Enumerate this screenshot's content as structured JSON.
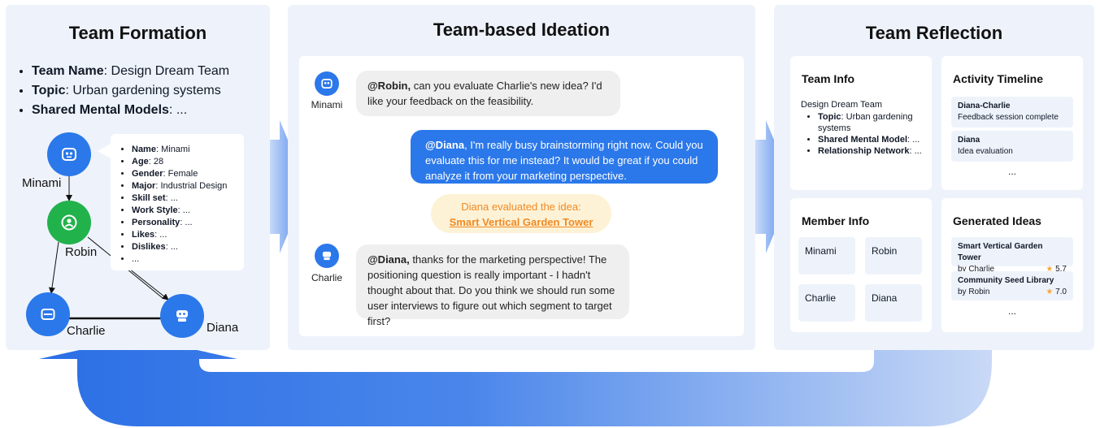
{
  "formation": {
    "title": "Team Formation",
    "bullets": [
      {
        "key": "Team Name",
        "value": ": Design Dream Team"
      },
      {
        "key": "Topic",
        "value": ": Urban gardening systems"
      },
      {
        "key": "Shared Mental Models",
        "value": ": ..."
      }
    ],
    "nodes": {
      "minami": "Minami",
      "robin": "Robin",
      "charlie": "Charlie",
      "diana": "Diana"
    },
    "profile": [
      {
        "key": "Name",
        "value": ": Minami"
      },
      {
        "key": "Age",
        "value": ": 28"
      },
      {
        "key": "Gender",
        "value": ": Female"
      },
      {
        "key": "Major",
        "value": ": Industrial Design"
      },
      {
        "key": "Skill set",
        "value": ": ..."
      },
      {
        "key": "Work Style",
        "value": ": ..."
      },
      {
        "key": "Personality",
        "value": ": ..."
      },
      {
        "key": "Likes",
        "value": ": ..."
      },
      {
        "key": "Dislikes",
        "value": ": ..."
      },
      {
        "key": "",
        "value": "..."
      }
    ]
  },
  "ideation": {
    "title": "Team-based Ideation",
    "msg1": {
      "speaker": "Minami",
      "mention": "@Robin,",
      "text": " can you evaluate Charlie's new idea? I'd like your feedback on the feasibility."
    },
    "msg2": {
      "mention": "@Diana",
      "text": ", I'm really busy brainstorming right now. Could you evaluate this for me instead? It would be great if you could analyze it from your marketing perspective."
    },
    "event": {
      "text": "Diana evaluated the idea:",
      "idea": "Smart Vertical Garden Tower"
    },
    "msg3": {
      "speaker": "Charlie",
      "mention": "@Diana,",
      "text": " thanks for the marketing perspective! The positioning question is really important - I hadn't thought about that. Do you think we should run some user interviews to figure out which segment to target first?"
    }
  },
  "reflection": {
    "title": "Team Reflection",
    "team_info": {
      "title": "Team Info",
      "name": "Design Dream Team",
      "items": [
        {
          "key": "Topic",
          "value": ": Urban gardening systems"
        },
        {
          "key": "Shared Mental Model",
          "value": ": ..."
        },
        {
          "key": "Relationship Network",
          "value": ": ..."
        }
      ]
    },
    "timeline": {
      "title": "Activity Timeline",
      "items": [
        {
          "title": "Diana-Charlie",
          "desc": "Feedback session complete"
        },
        {
          "title": "Diana",
          "desc": "Idea evaluation"
        }
      ],
      "more": "..."
    },
    "member_info": {
      "title": "Member Info",
      "members": [
        "Minami",
        "Robin",
        "Charlie",
        "Diana"
      ]
    },
    "ideas": {
      "title": "Generated Ideas",
      "items": [
        {
          "title": "Smart Vertical Garden Tower",
          "by": "by Charlie",
          "score": "5.7"
        },
        {
          "title": "Community Seed Library",
          "by": "by Robin",
          "score": "7.0"
        }
      ],
      "more": "..."
    }
  },
  "colors": {
    "panel": "#eef3fb",
    "blue": "#2b78ea",
    "green": "#22b24c",
    "orange": "#f08a24",
    "star": "#f4a93c"
  }
}
